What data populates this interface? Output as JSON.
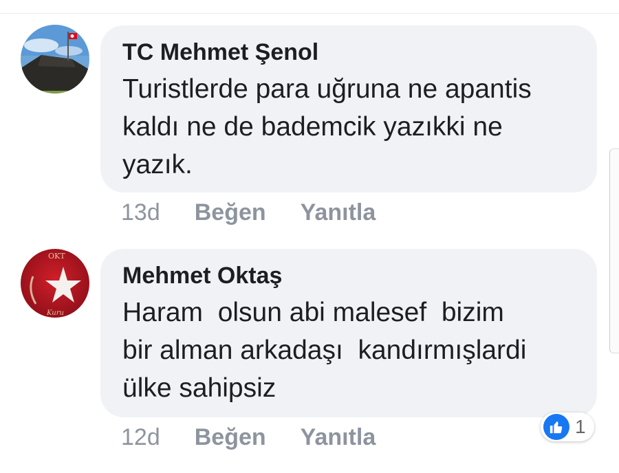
{
  "comments": [
    {
      "author": "TC Mehmet Şenol",
      "text": "Turistlerde para uğruna ne apantis\nkaldı ne de bademcik yazıkki ne\nyazık.",
      "time": "13d",
      "like_label": "Beğen",
      "reply_label": "Yanıtla"
    },
    {
      "author": "Mehmet Oktaş",
      "text": "Haram  olsun abi malesef  bizim\nbir alman arkadaşı  kandırmışlardi\nülke sahipsiz",
      "time": "12d",
      "like_label": "Beğen",
      "reply_label": "Yanıtla",
      "reactions": {
        "icon": "like-icon",
        "count": "1"
      },
      "avatar_text_top": "OKT",
      "avatar_text_bottom": "Kuru"
    }
  ],
  "colors": {
    "bubble_bg": "#f0f2f5",
    "meta_gray": "#8d949e",
    "like_blue": "#1877f2",
    "text": "#1c1e21"
  }
}
